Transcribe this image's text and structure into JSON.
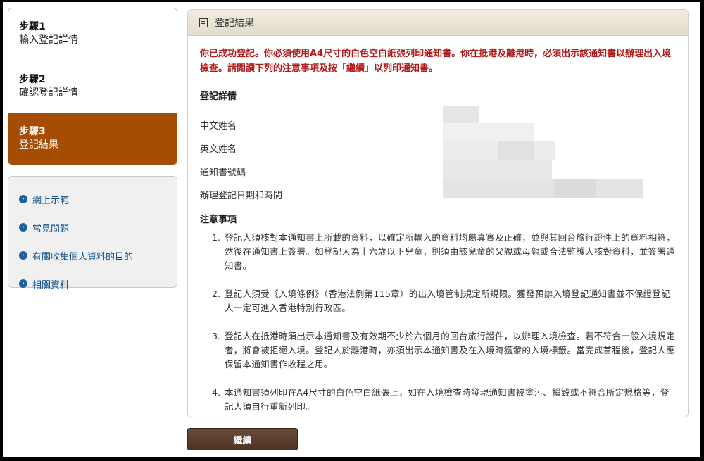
{
  "sidebar": {
    "steps": [
      {
        "title": "步驟1",
        "label": "輸入登記詳情"
      },
      {
        "title": "步驟2",
        "label": "確認登記詳情"
      },
      {
        "title": "步驟3",
        "label": "登記結果"
      }
    ],
    "links": [
      {
        "label": "網上示範"
      },
      {
        "label": "常見問題"
      },
      {
        "label": "有關收集個人資料的目的"
      },
      {
        "label": "相關資料"
      }
    ]
  },
  "panel": {
    "title": "登記結果",
    "success_message": "你已成功登記。你必須使用A4尺寸的白色空白紙張列印通知書。你在抵港及離港時，必須出示該通知書以辦理出入境檢查。請閱讀下列的注意事項及按「繼續」以列印通知書。",
    "details_title": "登記詳情",
    "fields": [
      {
        "label": "中文姓名"
      },
      {
        "label": "英文姓名"
      },
      {
        "label": "通知書號碼"
      },
      {
        "label": "辦理登記日期和時間"
      }
    ],
    "notes_title": "注意事項",
    "notes": [
      {
        "num": "1.",
        "text": "登記人須核對本通知書上所載的資料，以確定所輸入的資料均屬真實及正確，並與其回台旅行證件上的資料相符，然後在通知書上簽署。如登記人為十六歲以下兒童，則須由該兒童的父親或母親或合法監護人核對資料，並簽署通知書。"
      },
      {
        "num": "2.",
        "text": "登記人須受《入境條例》（香港法例第115章）的出入境管制規定所規限。獲發預辦入境登記通知書並不保證登記人一定可進入香港特別行政區。"
      },
      {
        "num": "3.",
        "text": "登記人在抵港時須出示本通知書及有效期不少於六個月的回台旅行證件，以辦理入境檢查。若不符合一般入境規定者，將會被拒絕入境。登記人於離港時，亦須出示本通知書及在入境時獲發的入境標籤。當完成首程後，登記人應保留本通知書作收程之用。"
      },
      {
        "num": "4.",
        "text": "本通知書須列印在A4尺寸的白色空白紙張上，如在入境檢查時發現通知書被塗污、損毀或不符合所定規格等，登記人須自行重新列印。"
      }
    ]
  },
  "continue_label": "繼續"
}
